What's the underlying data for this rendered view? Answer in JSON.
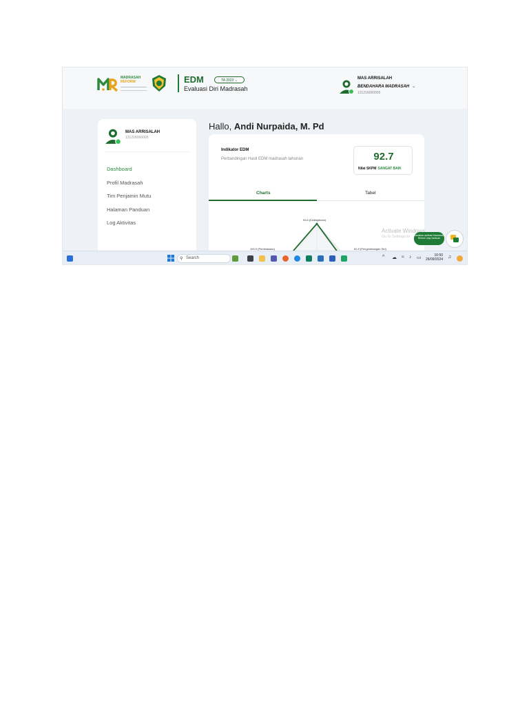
{
  "header": {
    "brand_line1": "MADRASAH",
    "brand_line2": "REFORM",
    "app_title": "EDM",
    "app_subtitle": "Evaluasi Diri Madrasah",
    "year_selector": "TA 2023",
    "user_name": "MAS ARRISALAH",
    "user_role": "BENDAHARA MADRASAH",
    "user_id": "131216060005"
  },
  "sidebar": {
    "user_name": "MAS ARRISALAH",
    "user_id": "131216060005",
    "items": [
      {
        "label": "Dashboard",
        "active": true
      },
      {
        "label": "Profil Madrasah",
        "active": false
      },
      {
        "label": "Tim Penjamin Mutu",
        "active": false
      },
      {
        "label": "Halaman Panduan",
        "active": false
      },
      {
        "label": "Log Aktivitas",
        "active": false
      }
    ]
  },
  "main": {
    "greeting_prefix": "Hallo,",
    "greeting_name": "Andi Nurpaida, M. Pd",
    "indicator_title": "Indikator EDM",
    "indicator_subtitle": "Perbandingan Hasil EDM madrasah tahunan",
    "score_value": "92.7",
    "score_label": "Nilai SKPM",
    "score_status": "SANGAT BAIK",
    "tabs": [
      {
        "label": "Charts",
        "active": true
      },
      {
        "label": "Tabel",
        "active": false
      }
    ],
    "radar_labels": {
      "top": "93.6 (Kedisiplinan)",
      "left": "100.0 (Pembiasaan)",
      "right": "81.8 (Pengembangan Diri)"
    }
  },
  "overlay": {
    "activate_title": "Activate Windows",
    "activate_sub": "Go to Settings to",
    "chat_text": "Jawaban aplikasi Madrasah Reform siap bantuan"
  },
  "taskbar": {
    "search_placeholder": "Search",
    "time": "10:50",
    "date": "26/09/2024"
  },
  "colors": {
    "brand_green": "#1f6b2e",
    "accent_green": "#2a8a3e",
    "brand_yellow": "#e6a51c"
  }
}
